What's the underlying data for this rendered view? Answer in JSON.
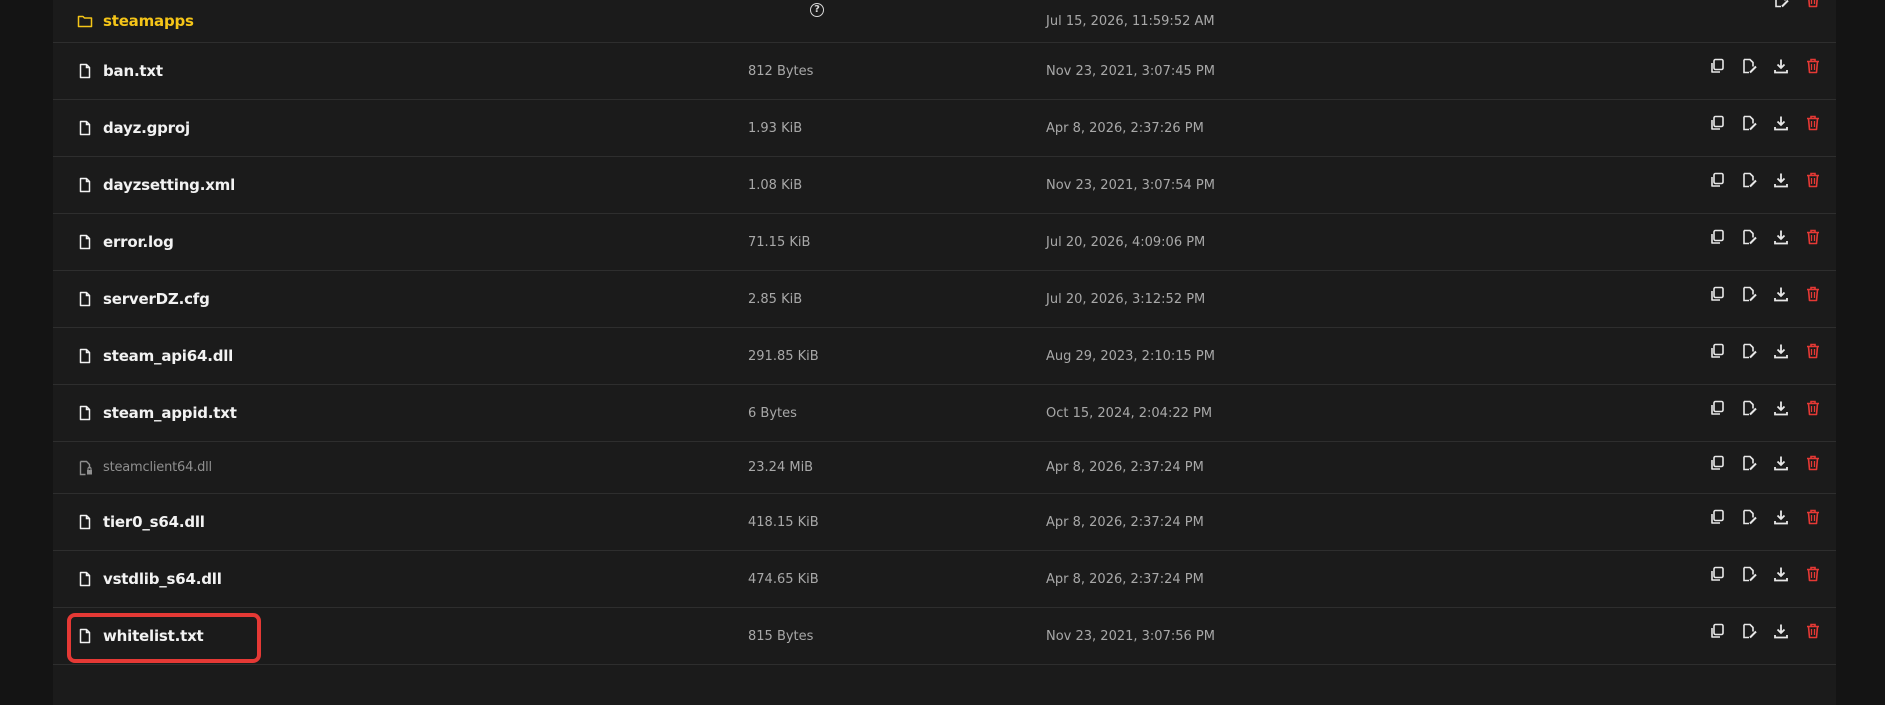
{
  "files": [
    {
      "name": "steamapps",
      "size": "",
      "modified": "Jul 15, 2026, 11:59:52 AM",
      "type": "folder",
      "icon": "folder-icon"
    },
    {
      "name": "ban.txt",
      "size": "812 Bytes",
      "modified": "Nov 23, 2021, 3:07:45 PM",
      "type": "file",
      "icon": "file-icon"
    },
    {
      "name": "dayz.gproj",
      "size": "1.93 KiB",
      "modified": "Apr 8, 2026, 2:37:26 PM",
      "type": "file",
      "icon": "file-icon"
    },
    {
      "name": "dayzsetting.xml",
      "size": "1.08 KiB",
      "modified": "Nov 23, 2021, 3:07:54 PM",
      "type": "file",
      "icon": "file-icon"
    },
    {
      "name": "error.log",
      "size": "71.15 KiB",
      "modified": "Jul 20, 2026, 4:09:06 PM",
      "type": "file",
      "icon": "file-icon"
    },
    {
      "name": "serverDZ.cfg",
      "size": "2.85 KiB",
      "modified": "Jul 20, 2026, 3:12:52 PM",
      "type": "file",
      "icon": "file-icon"
    },
    {
      "name": "steam_api64.dll",
      "size": "291.85 KiB",
      "modified": "Aug 29, 2023, 2:10:15 PM",
      "type": "file",
      "icon": "file-icon"
    },
    {
      "name": "steam_appid.txt",
      "size": "6 Bytes",
      "modified": "Oct 15, 2024, 2:04:22 PM",
      "type": "file",
      "icon": "file-icon"
    },
    {
      "name": "steamclient64.dll",
      "size": "23.24 MiB",
      "modified": "Apr 8, 2026, 2:37:24 PM",
      "type": "locked",
      "icon": "locked-file-icon"
    },
    {
      "name": "tier0_s64.dll",
      "size": "418.15 KiB",
      "modified": "Apr 8, 2026, 2:37:24 PM",
      "type": "file",
      "icon": "file-icon"
    },
    {
      "name": "vstdlib_s64.dll",
      "size": "474.65 KiB",
      "modified": "Apr 8, 2026, 2:37:24 PM",
      "type": "file",
      "icon": "file-icon"
    },
    {
      "name": "whitelist.txt",
      "size": "815 Bytes",
      "modified": "Nov 23, 2021, 3:07:56 PM",
      "type": "file",
      "icon": "file-icon"
    }
  ],
  "help_symbol": "?",
  "colors": {
    "folder": "#f5c518",
    "delete": "#e53935",
    "highlight": "#e53935"
  }
}
